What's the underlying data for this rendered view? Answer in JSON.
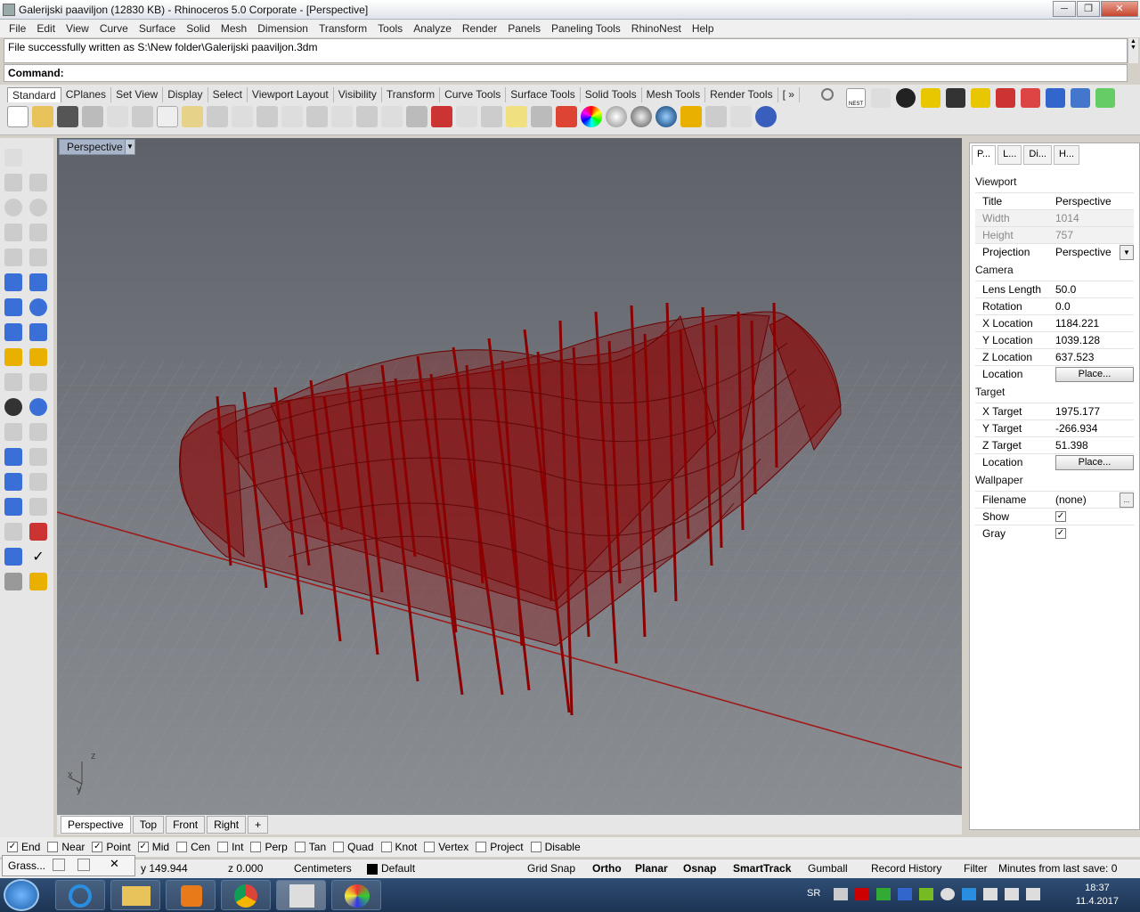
{
  "window": {
    "title": "Galerijski paaviljon (12830 KB) - Rhinoceros  5.0 Corporate - [Perspective]",
    "minimize": "─",
    "restore": "❐",
    "close": "✕"
  },
  "menu": [
    "File",
    "Edit",
    "View",
    "Curve",
    "Surface",
    "Solid",
    "Mesh",
    "Dimension",
    "Transform",
    "Tools",
    "Analyze",
    "Render",
    "Panels",
    "Paneling Tools",
    "RhinoNest",
    "Help"
  ],
  "command_history": "File successfully written as S:\\New folder\\Galerijski paaviljon.3dm",
  "command_label": "Command:",
  "toolbar_tabs": [
    "Standard",
    "CPlanes",
    "Set View",
    "Display",
    "Select",
    "Viewport Layout",
    "Visibility",
    "Transform",
    "Curve Tools",
    "Surface Tools",
    "Solid Tools",
    "Mesh Tools",
    "Render Tools",
    "[ »"
  ],
  "nest_label": "NEST",
  "viewport": {
    "title": "Perspective",
    "arrow": "▼",
    "axis_z": "z",
    "axis_x": "x",
    "axis_y": "y"
  },
  "viewport_tabs": [
    "Perspective",
    "Top",
    "Front",
    "Right",
    "+"
  ],
  "panel": {
    "tabs": [
      "P...",
      "L...",
      "Di...",
      "H..."
    ],
    "viewport_section": "Viewport",
    "title_label": "Title",
    "title_value": "Perspective",
    "width_label": "Width",
    "width_value": "1014",
    "height_label": "Height",
    "height_value": "757",
    "projection_label": "Projection",
    "projection_value": "Perspective",
    "camera_section": "Camera",
    "lens_label": "Lens Length",
    "lens_value": "50.0",
    "rotation_label": "Rotation",
    "rotation_value": "0.0",
    "xloc_label": "X Location",
    "xloc_value": "1184.221",
    "yloc_label": "Y Location",
    "yloc_value": "1039.128",
    "zloc_label": "Z Location",
    "zloc_value": "637.523",
    "location_label": "Location",
    "place_label": "Place...",
    "target_section": "Target",
    "xt_label": "X Target",
    "xt_value": "1975.177",
    "yt_label": "Y Target",
    "yt_value": "-266.934",
    "zt_label": "Z Target",
    "zt_value": "51.398",
    "location2_label": "Location",
    "wallpaper_section": "Wallpaper",
    "filename_label": "Filename",
    "filename_value": "(none)",
    "browse": "...",
    "show_label": "Show",
    "gray_label": "Gray",
    "check": "✓"
  },
  "osnaps": [
    {
      "label": "End",
      "checked": true
    },
    {
      "label": "Near",
      "checked": false
    },
    {
      "label": "Point",
      "checked": true
    },
    {
      "label": "Mid",
      "checked": true
    },
    {
      "label": "Cen",
      "checked": false
    },
    {
      "label": "Int",
      "checked": false
    },
    {
      "label": "Perp",
      "checked": false
    },
    {
      "label": "Tan",
      "checked": false
    },
    {
      "label": "Quad",
      "checked": false
    },
    {
      "label": "Knot",
      "checked": false
    },
    {
      "label": "Vertex",
      "checked": false
    },
    {
      "label": "Project",
      "checked": false
    },
    {
      "label": "Disable",
      "checked": false
    }
  ],
  "status": {
    "grass": "Grass...",
    "y": "y 149.944",
    "z": "z 0.000",
    "units": "Centimeters",
    "layer": "Default",
    "grid_snap": "Grid Snap",
    "ortho": "Ortho",
    "planar": "Planar",
    "osnap": "Osnap",
    "smarttrack": "SmartTrack",
    "gumball": "Gumball",
    "record_history": "Record History",
    "filter": "Filter",
    "minutes": "Minutes from last save: 0"
  },
  "tray": {
    "lang": "SR",
    "time": "18:37",
    "date": "11.4.2017"
  },
  "colors": {
    "model_red": "#8b0000",
    "viewport_bg": "#6b6f75",
    "accent": "#cc0000"
  }
}
